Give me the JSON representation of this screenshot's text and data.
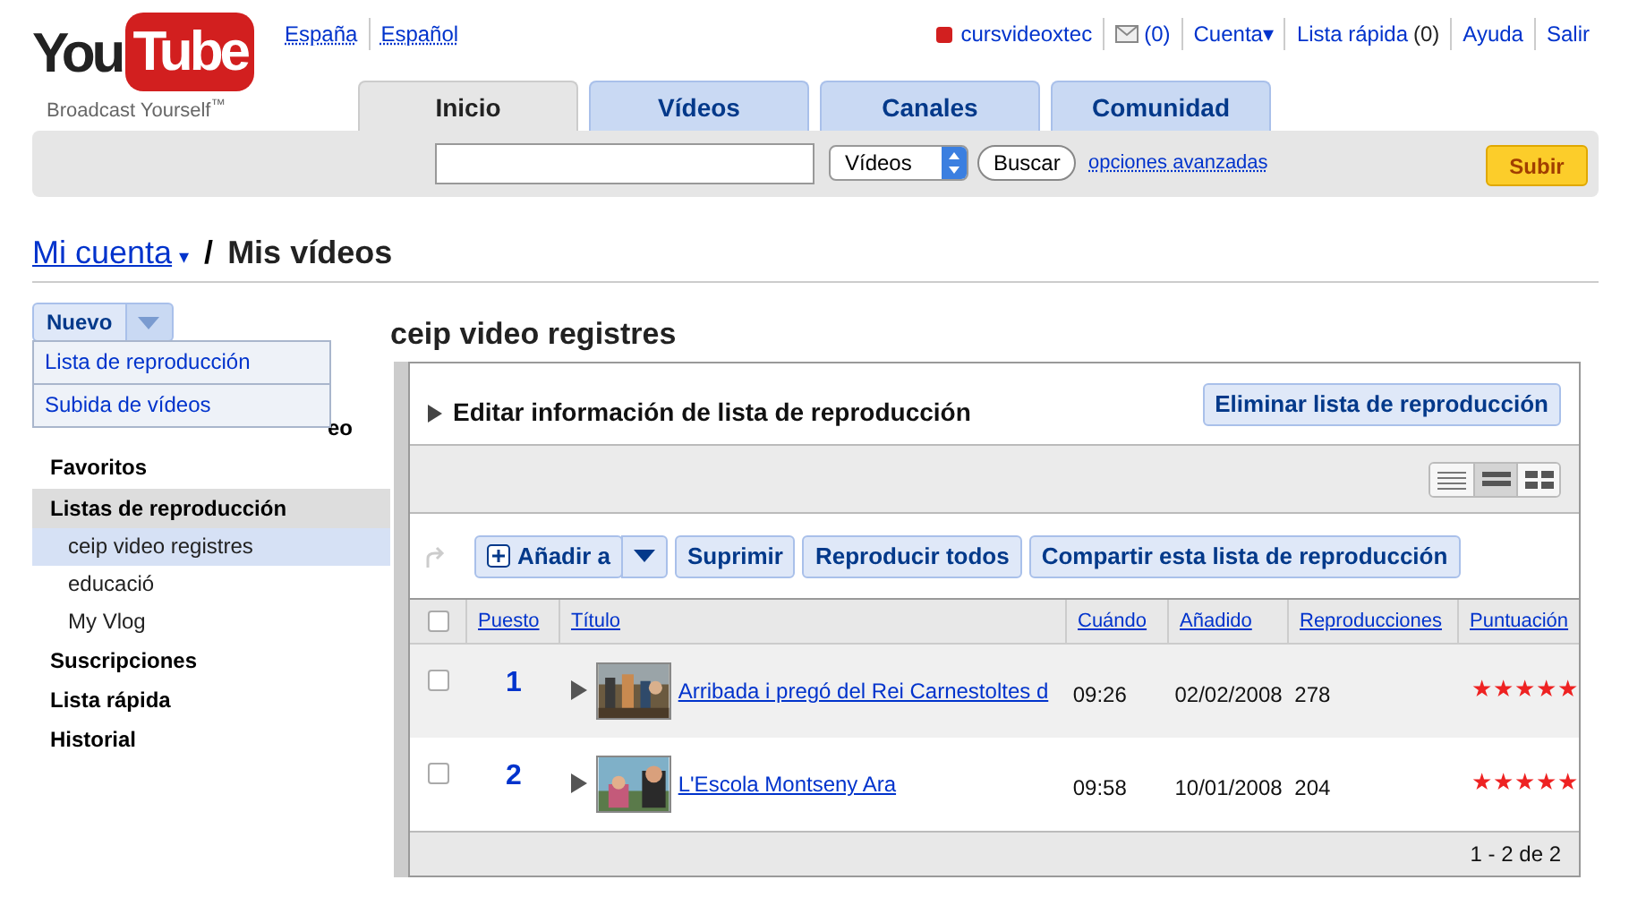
{
  "logo": {
    "part1": "You",
    "part2": "Tube",
    "tagline": "Broadcast Yourself$^{™}$"
  },
  "locale_links": [
    "España",
    "Español"
  ],
  "user_links": [
    {
      "kind": "user",
      "text": "cursvideoxtec"
    },
    {
      "kind": "mail",
      "text": "(0)"
    },
    {
      "kind": "menu",
      "text": "Cuenta",
      "caret": "▾"
    },
    {
      "kind": "count",
      "text": "Lista rápida",
      "count": "(0)"
    },
    {
      "kind": "link",
      "text": "Ayuda"
    },
    {
      "kind": "link",
      "text": "Salir"
    }
  ],
  "tabs": [
    {
      "label": "Inicio",
      "selected": true
    },
    {
      "label": "Vídeos",
      "selected": false
    },
    {
      "label": "Canales",
      "selected": false
    },
    {
      "label": "Comunidad",
      "selected": false
    }
  ],
  "search": {
    "category": "Vídeos",
    "button": "Buscar",
    "advanced": "opciones avanzadas",
    "upload": "Subir"
  },
  "breadcrumb": {
    "account": "Mi cuenta",
    "caret": "▾",
    "separator": "/",
    "page": "Mis vídeos"
  },
  "new_button": {
    "label": "Nuevo",
    "expanded": true,
    "menu": [
      "Lista de reproducción",
      "Subida de vídeos"
    ]
  },
  "sidebar": {
    "items": [
      {
        "label": "eo",
        "kind": "covered",
        "selected": false
      },
      {
        "label": "Favoritos",
        "selected": false
      },
      {
        "label": "Listas de reproducción",
        "selected": false,
        "kind": "header",
        "children": [
          {
            "label": "ceip video registres",
            "selected": true
          },
          {
            "label": "educació",
            "selected": false
          },
          {
            "label": "My Vlog",
            "selected": false
          }
        ]
      },
      {
        "label": "Suscripciones",
        "selected": false
      },
      {
        "label": "Lista rápida",
        "selected": false
      },
      {
        "label": "Historial",
        "selected": false
      }
    ]
  },
  "playlist": {
    "title": "ceip video registres",
    "edit_toggle": "Editar información de lista de reproducción",
    "delete_button": "Eliminar lista de reproducción",
    "view_modes": [
      {
        "selected": false
      },
      {
        "selected": true
      },
      {
        "selected": false
      }
    ],
    "actions": [
      "Añadir a",
      "Suprimir",
      "Reproducir todos",
      "Compartir esta lista de reproducción"
    ],
    "select_all_checked": false,
    "columns": [
      "Puesto",
      "Título",
      "Cuándo",
      "Añadido",
      "Reproducciones",
      "Puntuación"
    ],
    "rows": [
      {
        "checked": false,
        "rank": "1",
        "title": "Arribada i pregó del Rei Carnestoltes d",
        "duration": "09:26",
        "added": "02/02/2008",
        "views": "278",
        "stars": 5
      },
      {
        "checked": false,
        "rank": "2",
        "title": "L'Escola Montseny Ara",
        "duration": "09:58",
        "added": "10/01/2008",
        "views": "204",
        "stars": 5
      }
    ],
    "pagination": "1 - 2 de 2"
  }
}
